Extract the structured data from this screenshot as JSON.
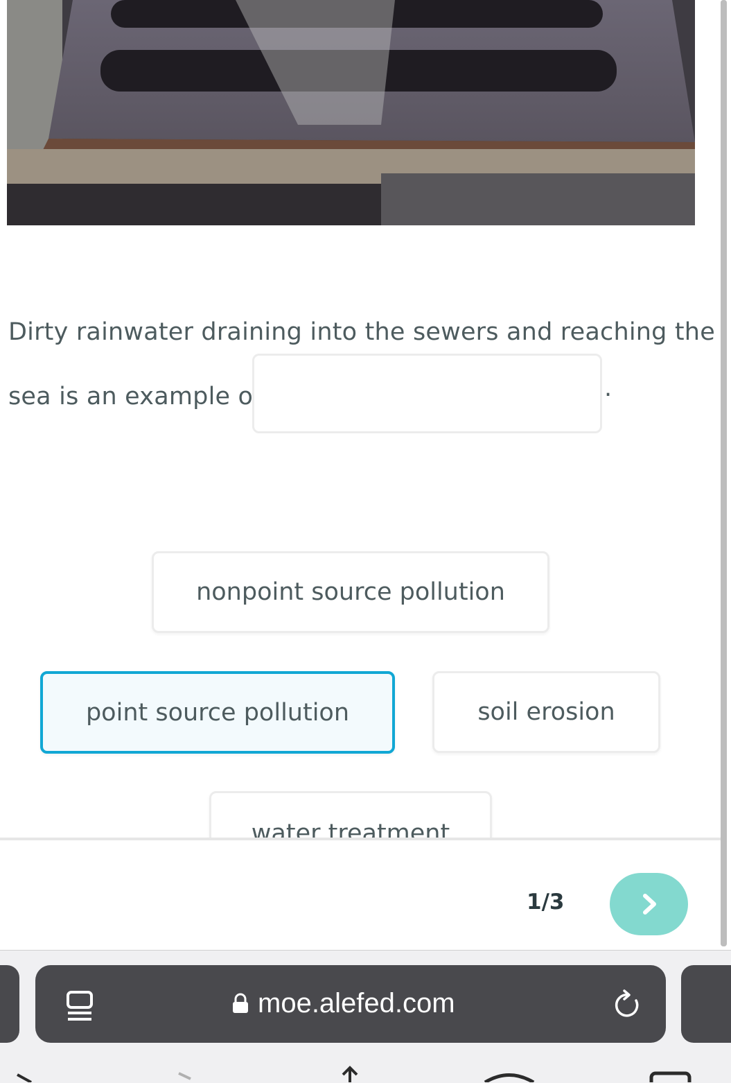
{
  "question": {
    "line1": "Dirty rainwater draining into the sewers and reaching the",
    "line2": "sea is an example of",
    "end": "."
  },
  "options": [
    {
      "label": "nonpoint source pollution",
      "selected": false
    },
    {
      "label": "point source pollution",
      "selected": true
    },
    {
      "label": "soil erosion",
      "selected": false
    },
    {
      "label": "water treatment",
      "selected": false
    }
  ],
  "footer": {
    "progress": "1/3",
    "next_icon": "chevron-right-icon"
  },
  "browser": {
    "url": "moe.alefed.com",
    "tabs_icon": "tabs-icon",
    "lock_icon": "lock-icon",
    "reload_icon": "reload-icon"
  },
  "colors": {
    "accent": "#11a7d4",
    "next_button": "#83d9cf",
    "text": "#4d5b5e"
  }
}
